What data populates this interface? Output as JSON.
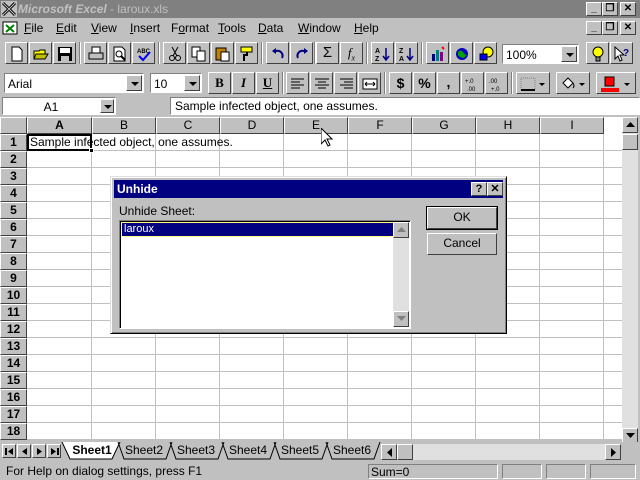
{
  "window": {
    "brand": "Microsoft",
    "app": "Excel",
    "separator": "-",
    "file": "laroux.xls",
    "caption_buttons": [
      "_",
      "❐",
      "✕"
    ]
  },
  "menu": {
    "items": [
      {
        "label": "File",
        "key": "F",
        "rest": "ile"
      },
      {
        "label": "Edit",
        "key": "E",
        "rest": "dit"
      },
      {
        "label": "View",
        "key": "V",
        "rest": "iew"
      },
      {
        "label": "Insert",
        "key": "I",
        "rest": "nsert"
      },
      {
        "label": "Format",
        "pre": "F",
        "key": "o",
        "rest": "rmat"
      },
      {
        "label": "Tools",
        "key": "T",
        "rest": "ools"
      },
      {
        "label": "Data",
        "key": "D",
        "rest": "ata"
      },
      {
        "label": "Window",
        "key": "W",
        "rest": "indow"
      },
      {
        "label": "Help",
        "key": "H",
        "rest": "elp"
      }
    ],
    "mdi_buttons": [
      "_",
      "❐",
      "✕"
    ]
  },
  "standard_toolbar": {
    "buttons": [
      "new-icon",
      "open-icon",
      "save-icon",
      "print-icon",
      "print-preview-icon",
      "spelling-icon",
      "cut-icon",
      "copy-icon",
      "paste-icon",
      "format-painter-icon",
      "undo-icon",
      "redo-icon",
      "autosum-icon",
      "function-wizard-icon",
      "sort-ascending-icon",
      "sort-descending-icon",
      "chart-wizard-icon",
      "map-icon",
      "drawing-icon",
      "tipwizard-icon",
      "help-icon"
    ],
    "zoom": "100%",
    "autosum_glyph": "Σ",
    "function_glyph": "f",
    "function_sub": "x"
  },
  "format_toolbar": {
    "font": "Arial",
    "size": "10",
    "bold": "B",
    "italic": "I",
    "underline": "U",
    "currency": "$",
    "percent": "%",
    "comma": ","
  },
  "formula_bar": {
    "name_box": "A1",
    "content": "Sample infected object, one assumes."
  },
  "grid": {
    "columns": [
      "A",
      "B",
      "C",
      "D",
      "E",
      "F",
      "G",
      "H",
      "I"
    ],
    "rows": [
      "1",
      "2",
      "3",
      "4",
      "5",
      "6",
      "7",
      "8",
      "9",
      "10",
      "11",
      "12",
      "13",
      "14",
      "15",
      "16",
      "17",
      "18"
    ],
    "a1": "Sample infected object, one assumes."
  },
  "sheets": {
    "tabs": [
      "Sheet1",
      "Sheet2",
      "Sheet3",
      "Sheet4",
      "Sheet5",
      "Sheet6"
    ],
    "active": "Sheet1"
  },
  "status": {
    "message": "For Help on dialog settings, press F1",
    "sum": "Sum=0"
  },
  "dialog": {
    "title": "Unhide",
    "help_button": "?",
    "close_button": "✕",
    "label": "Unhide Sheet:",
    "list_items": [
      "laroux"
    ],
    "ok": "OK",
    "cancel": "Cancel"
  },
  "colors": {
    "title_active": "#000080",
    "title_inactive": "#808080",
    "face": "#c0c0c0"
  }
}
